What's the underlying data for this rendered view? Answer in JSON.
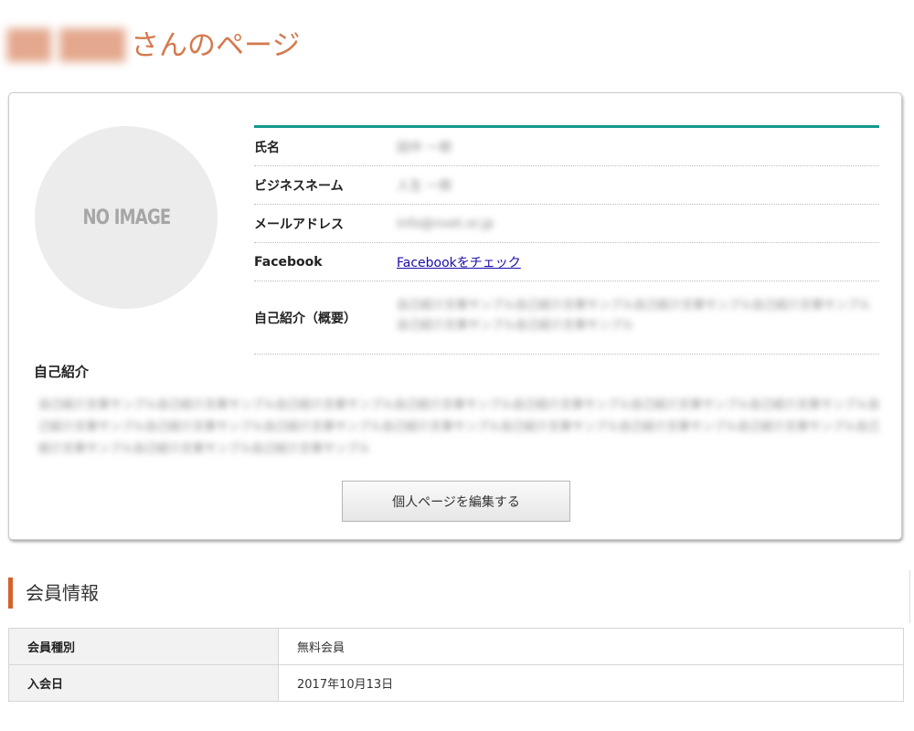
{
  "page": {
    "title_name": "██ ███",
    "title_suffix": "さんのページ"
  },
  "profile": {
    "avatar_text": "NO IMAGE",
    "fields": [
      {
        "label": "氏名",
        "value": "田中 一郎"
      },
      {
        "label": "ビジネスネーム",
        "value": "人生 一郎"
      },
      {
        "label": "メールアドレス",
        "value": "info@nvet.or.jp"
      },
      {
        "label": "Facebook",
        "value": "Facebookをチェック"
      },
      {
        "label": "自己紹介（概要）",
        "value": "自己紹介文章サンプル自己紹介文章サンプル自己紹介文章サンプル自己紹介文章サンプル自己紹介文章サンプル自己紹介文章サンプル"
      }
    ],
    "intro_heading": "自己紹介",
    "intro_text": "自己紹介文章サンプル自己紹介文章サンプル自己紹介文章サンプル自己紹介文章サンプル自己紹介文章サンプル自己紹介文章サンプル自己紹介文章サンプル自己紹介文章サンプル自己紹介文章サンプル自己紹介文章サンプル自己紹介文章サンプル自己紹介文章サンプル自己紹介文章サンプル自己紹介文章サンプル自己紹介文章サンプル自己紹介文章サンプル自己紹介文章サンプル",
    "edit_button_label": "個人ページを編集する"
  },
  "member_info": {
    "heading": "会員情報",
    "rows": [
      {
        "label": "会員種別",
        "value": "無料会員"
      },
      {
        "label": "入会日",
        "value": "2017年10月13日"
      }
    ]
  },
  "colors": {
    "title_accent": "#d47a4f",
    "table_top_border": "#13998f",
    "section_accent": "#d4622a",
    "link": "#1a0dab"
  }
}
